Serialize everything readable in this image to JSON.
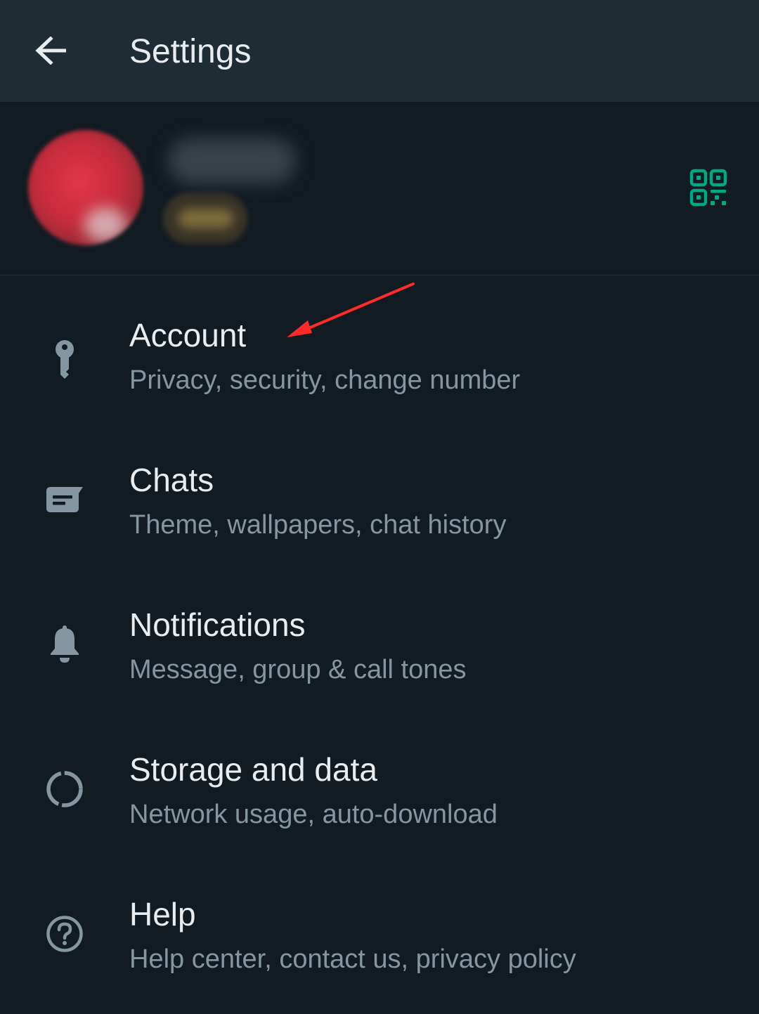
{
  "appbar": {
    "title": "Settings",
    "back_icon": "arrow-left-icon"
  },
  "profile": {
    "name": "",
    "status": "",
    "avatar": "blurred-avatar",
    "qr_icon": "qr-code-icon",
    "qr_color": "#00a884"
  },
  "settings": {
    "items": [
      {
        "title": "Account",
        "subtitle": "Privacy, security, change number",
        "icon": "key-icon"
      },
      {
        "title": "Chats",
        "subtitle": "Theme, wallpapers, chat history",
        "icon": "chat-icon"
      },
      {
        "title": "Notifications",
        "subtitle": "Message, group & call tones",
        "icon": "bell-icon"
      },
      {
        "title": "Storage and data",
        "subtitle": "Network usage, auto-download",
        "icon": "storage-circle-icon"
      },
      {
        "title": "Help",
        "subtitle": "Help center, contact us, privacy policy",
        "icon": "help-circle-icon"
      }
    ]
  },
  "colors": {
    "background": "#121b22",
    "appbar": "#1f2c34",
    "primary_text": "#e9edef",
    "secondary_text": "#8696a0",
    "icon": "#8696a0",
    "accent": "#00a884",
    "annotation": "#ff2a2a"
  },
  "annotation": {
    "type": "red-arrow",
    "target": "Account"
  }
}
